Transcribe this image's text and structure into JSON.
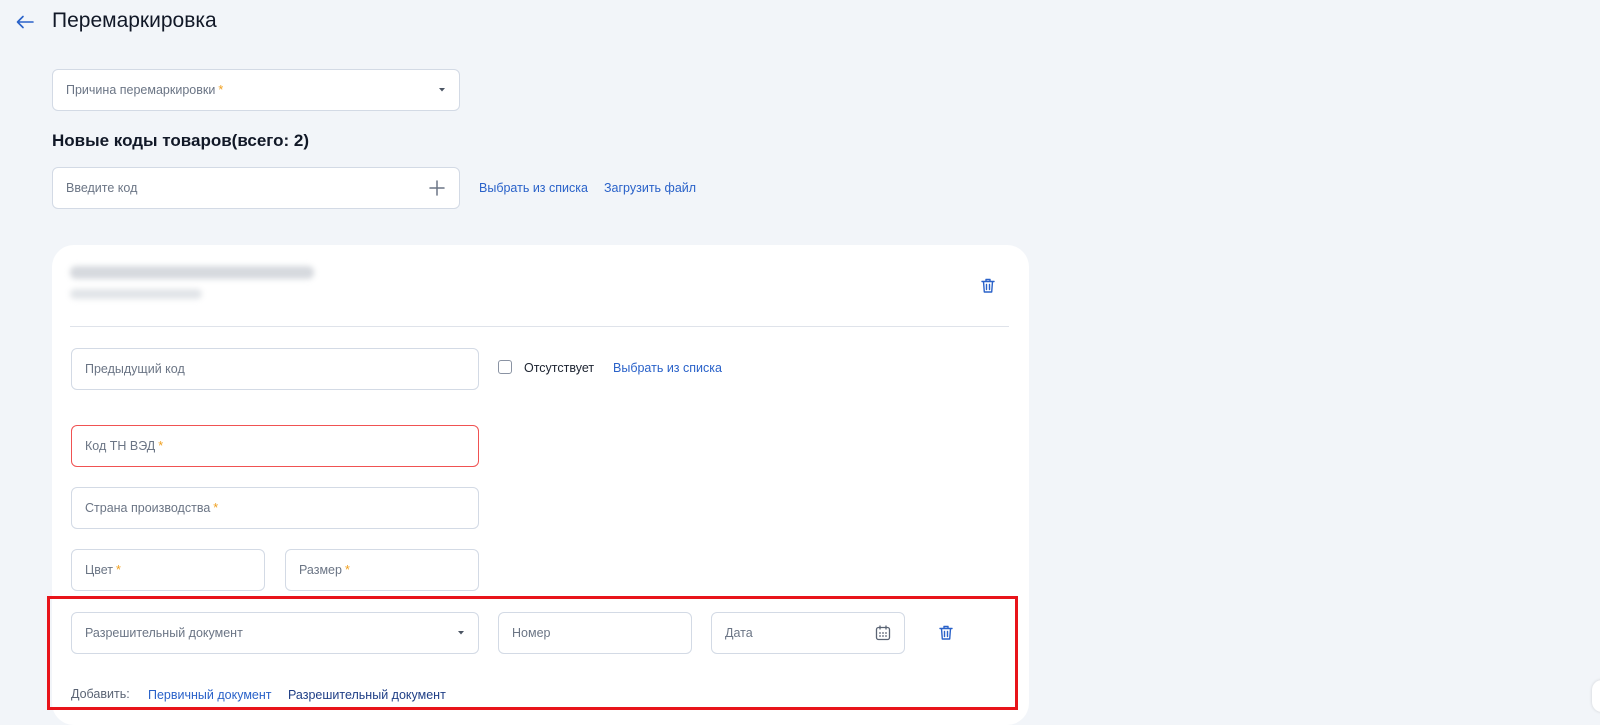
{
  "header": {
    "title": "Перемаркировка"
  },
  "reason": {
    "placeholder": "Причина перемаркировки",
    "required_mark": "*"
  },
  "codes": {
    "section_title": "Новые коды товаров(всего: 2)",
    "input_placeholder": "Введите код",
    "choose_from_list": "Выбрать из списка",
    "upload_file": "Загрузить файл"
  },
  "item": {
    "previous_code_placeholder": "Предыдущий код",
    "absent_label": "Отсутствует",
    "choose_from_list": "Выбрать из списка",
    "tnved_label": "Код ТН ВЭД",
    "country_label": "Страна производства",
    "color_label": "Цвет",
    "size_label": "Размер",
    "required_mark": "*",
    "permit": {
      "doc_type_placeholder": "Разрешительный документ",
      "number_placeholder": "Номер",
      "date_placeholder": "Дата"
    },
    "add": {
      "label": "Добавить:",
      "primary_doc": "Первичный документ",
      "permit_doc": "Разрешительный документ"
    }
  },
  "colors": {
    "accent": "#2a62c9",
    "required": "#f0a020",
    "error_border": "#f05252",
    "highlight": "#e8141a",
    "background": "#f2f5f9"
  },
  "icons": [
    "arrow-left-icon",
    "chevron-down-icon",
    "plus-icon",
    "trash-icon",
    "calendar-icon"
  ]
}
